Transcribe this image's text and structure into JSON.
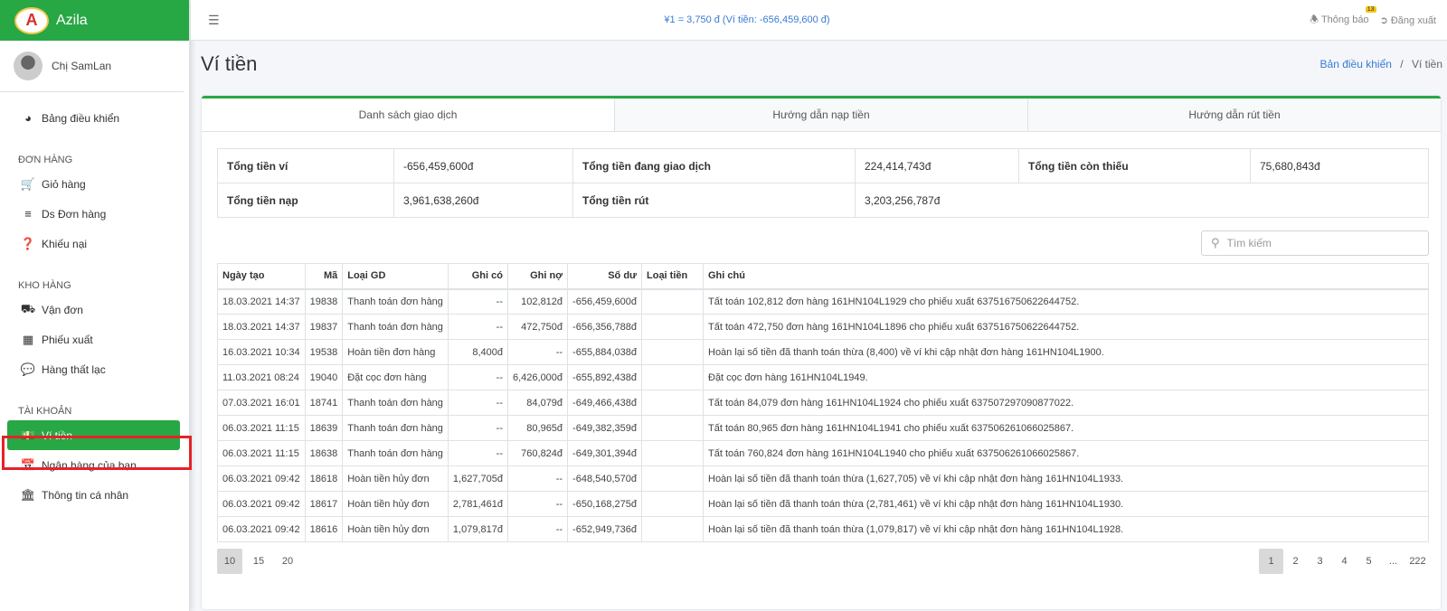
{
  "brand": {
    "name": "Azila",
    "logo_text": "A"
  },
  "user": {
    "name": "Chị SamLan"
  },
  "sidebar": {
    "dashboard": "Bảng điều khiển",
    "sections": [
      {
        "header": "ĐƠN HÀNG",
        "items": [
          "Giỏ hàng",
          "Ds Đơn hàng",
          "Khiếu nại"
        ]
      },
      {
        "header": "KHO HÀNG",
        "items": [
          "Vận đơn",
          "Phiếu xuất",
          "Hàng thất lạc"
        ]
      },
      {
        "header": "TÀI KHOẢN",
        "items": [
          "Ví tiền",
          "Ngân hàng của bạn",
          "Thông tin cá nhân"
        ]
      }
    ]
  },
  "topbar": {
    "rate": "¥1 = 3,750 đ (Ví tiền: -656,459,600 đ)",
    "notifications_label": "Thông báo",
    "notifications_count": "13",
    "logout_label": "Đăng xuất"
  },
  "page": {
    "title": "Ví tiền",
    "breadcrumb_link": "Bản điều khiển",
    "breadcrumb_sep": "/",
    "breadcrumb_current": "Ví tiền"
  },
  "tabs": [
    "Danh sách giao dịch",
    "Hướng dẫn nạp tiền",
    "Hướng dẫn rút tiền"
  ],
  "summary": {
    "wallet_label": "Tổng tiền ví",
    "wallet_value": "-656,459,600đ",
    "trading_label": "Tổng tiền đang giao dịch",
    "trading_value": "224,414,743đ",
    "missing_label": "Tổng tiền còn thiếu",
    "missing_value": "75,680,843đ",
    "deposit_label": "Tổng tiền nạp",
    "deposit_value": "3,961,638,260đ",
    "withdraw_label": "Tổng tiền rút",
    "withdraw_value": "3,203,256,787đ"
  },
  "search": {
    "placeholder": "Tìm kiếm"
  },
  "table": {
    "headers": [
      "Ngày tạo",
      "Mã",
      "Loại GD",
      "Ghi có",
      "Ghi nợ",
      "Số dư",
      "Loại tiền",
      "Ghi chú"
    ],
    "rows": [
      [
        "18.03.2021 14:37",
        "19838",
        "Thanh toán đơn hàng",
        "--",
        "102,812đ",
        "-656,459,600đ",
        "",
        "Tất toán 102,812 đơn hàng 161HN104L1929 cho phiếu xuất 637516750622644752."
      ],
      [
        "18.03.2021 14:37",
        "19837",
        "Thanh toán đơn hàng",
        "--",
        "472,750đ",
        "-656,356,788đ",
        "",
        "Tất toán 472,750 đơn hàng 161HN104L1896 cho phiếu xuất 637516750622644752."
      ],
      [
        "16.03.2021 10:34",
        "19538",
        "Hoàn tiền đơn hàng",
        "8,400đ",
        "--",
        "-655,884,038đ",
        "",
        "Hoàn lại số tiền đã thanh toán thừa (8,400) về ví khi cập nhật đơn hàng 161HN104L1900."
      ],
      [
        "11.03.2021 08:24",
        "19040",
        "Đặt cọc đơn hàng",
        "--",
        "6,426,000đ",
        "-655,892,438đ",
        "",
        "Đặt cọc đơn hàng 161HN104L1949."
      ],
      [
        "07.03.2021 16:01",
        "18741",
        "Thanh toán đơn hàng",
        "--",
        "84,079đ",
        "-649,466,438đ",
        "",
        "Tất toán 84,079 đơn hàng 161HN104L1924 cho phiếu xuất 637507297090877022."
      ],
      [
        "06.03.2021 11:15",
        "18639",
        "Thanh toán đơn hàng",
        "--",
        "80,965đ",
        "-649,382,359đ",
        "",
        "Tất toán 80,965 đơn hàng 161HN104L1941 cho phiếu xuất 637506261066025867."
      ],
      [
        "06.03.2021 11:15",
        "18638",
        "Thanh toán đơn hàng",
        "--",
        "760,824đ",
        "-649,301,394đ",
        "",
        "Tất toán 760,824 đơn hàng 161HN104L1940 cho phiếu xuất 637506261066025867."
      ],
      [
        "06.03.2021 09:42",
        "18618",
        "Hoàn tiền hủy đơn",
        "1,627,705đ",
        "--",
        "-648,540,570đ",
        "",
        "Hoàn lại số tiền đã thanh toán thừa (1,627,705) về ví khi cập nhật đơn hàng 161HN104L1933."
      ],
      [
        "06.03.2021 09:42",
        "18617",
        "Hoàn tiền hủy đơn",
        "2,781,461đ",
        "--",
        "-650,168,275đ",
        "",
        "Hoàn lại số tiền đã thanh toán thừa (2,781,461) về ví khi cập nhật đơn hàng 161HN104L1930."
      ],
      [
        "06.03.2021 09:42",
        "18616",
        "Hoàn tiền hủy đơn",
        "1,079,817đ",
        "--",
        "-652,949,736đ",
        "",
        "Hoàn lại số tiền đã thanh toán thừa (1,079,817) về ví khi cập nhật đơn hàng 161HN104L1928."
      ]
    ]
  },
  "page_sizes": [
    "10",
    "15",
    "20"
  ],
  "pagination": [
    "1",
    "2",
    "3",
    "4",
    "5",
    "...",
    "222"
  ],
  "colors": {
    "accent": "#28a745",
    "highlight": "#e5222a",
    "link": "#3a7bd5"
  }
}
